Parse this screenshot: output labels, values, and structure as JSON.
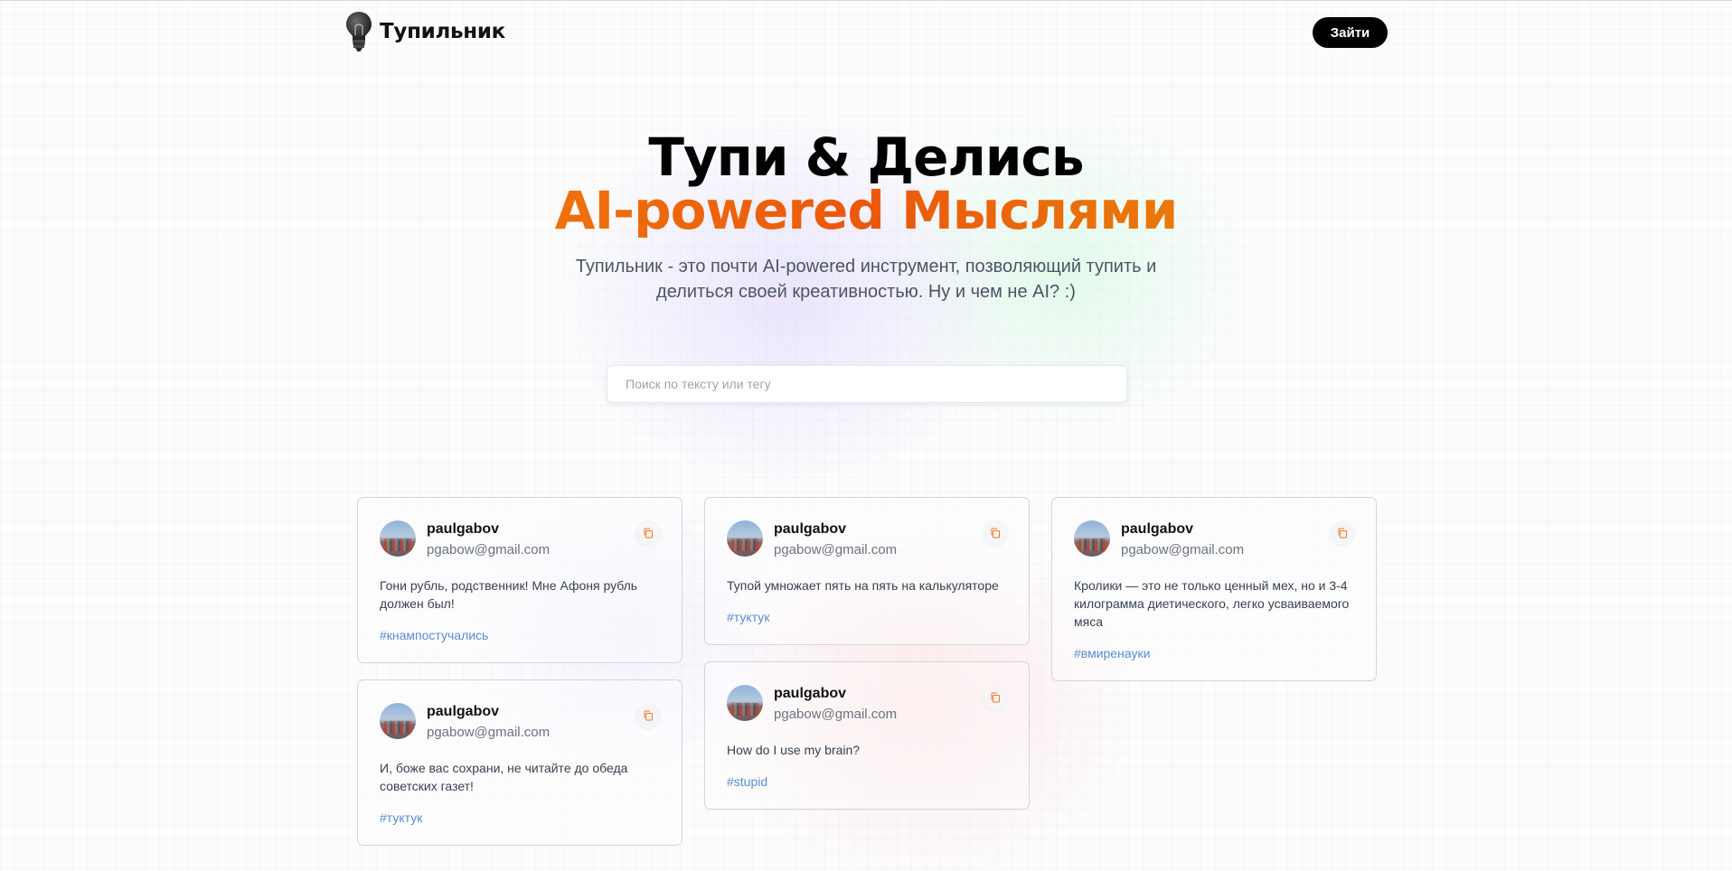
{
  "nav": {
    "logo_text": "Тупильник",
    "login_label": "Зайти"
  },
  "hero": {
    "title": "Тупи & Делись",
    "accent": "AI-powered Мыслями",
    "description": "Тупильник - это почти AI-powered инструмент, позволяющий тупить и делиться своей креативностью. Ну и чем не AI? :)",
    "accent_colors": [
      "#f59e0b",
      "#ea580c",
      "#eab308"
    ]
  },
  "search": {
    "placeholder": "Поиск по тексту или тегу",
    "value": ""
  },
  "posts": [
    {
      "username": "paulgabov",
      "email": "pgabow@gmail.com",
      "text": "Гони рубль, родственник! Мне Афоня рубль должен был!",
      "tag": "#кнампостучались"
    },
    {
      "username": "paulgabov",
      "email": "pgabow@gmail.com",
      "text": "И, боже вас сохрани, не читайте до обеда советских газет!",
      "tag": "#туктук"
    },
    {
      "username": "paulgabov",
      "email": "pgabow@gmail.com",
      "text": "Тупой умножает пять на пять на калькуляторе",
      "tag": "#туктук"
    },
    {
      "username": "paulgabov",
      "email": "pgabow@gmail.com",
      "text": "How do I use my brain?",
      "tag": "#stupid"
    },
    {
      "username": "paulgabov",
      "email": "pgabow@gmail.com",
      "text": "Кролики — это не только ценный мех, но и 3-4 килограмма диетического, легко усваиваемого мяса",
      "tag": "#вмиренауки"
    }
  ],
  "icons": {
    "logo": "lightbulb-icon",
    "copy": "copy-icon",
    "avatar": "user-avatar"
  },
  "colors": {
    "tag": "#5b8bd4",
    "button_bg": "#000000",
    "copy_icon": "#f97316"
  }
}
